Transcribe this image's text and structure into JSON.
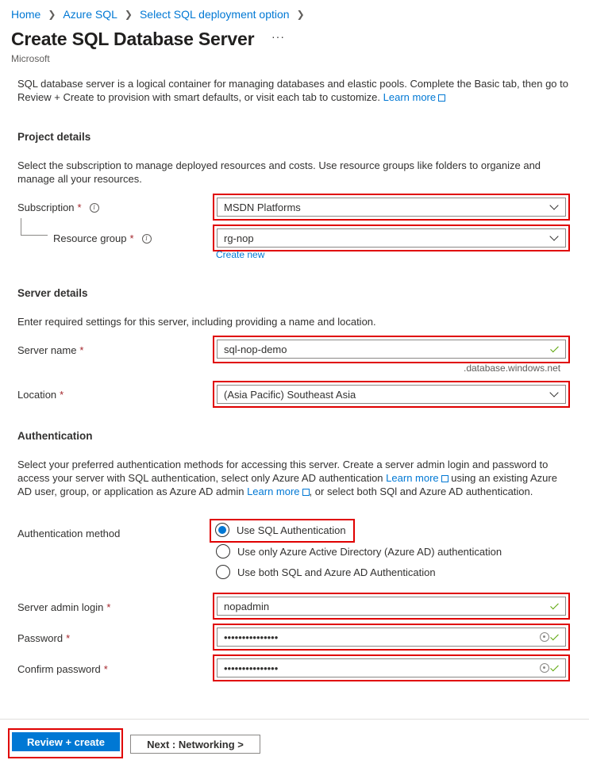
{
  "breadcrumb": {
    "items": [
      "Home",
      "Azure SQL",
      "Select SQL deployment option"
    ]
  },
  "header": {
    "title": "Create SQL Database Server",
    "more_label": "···",
    "publisher": "Microsoft"
  },
  "intro": {
    "text": "SQL database server is a logical container for managing databases and elastic pools. Complete the Basic tab, then go to Review + Create to provision with smart defaults, or visit each tab to customize.",
    "learn_more": "Learn more"
  },
  "project_details": {
    "heading": "Project details",
    "description": "Select the subscription to manage deployed resources and costs. Use resource groups like folders to organize and manage all your resources.",
    "subscription_label": "Subscription",
    "subscription_value": "MSDN Platforms",
    "resource_group_label": "Resource group",
    "resource_group_value": "rg-nop",
    "create_new": "Create new"
  },
  "server_details": {
    "heading": "Server details",
    "description": "Enter required settings for this server, including providing a name and location.",
    "server_name_label": "Server name",
    "server_name_value": "sql-nop-demo",
    "server_name_suffix": ".database.windows.net",
    "location_label": "Location",
    "location_value": "(Asia Pacific) Southeast Asia"
  },
  "authentication": {
    "heading": "Authentication",
    "description_1": "Select your preferred authentication methods for accessing this server. Create a server admin login and password to access your server with SQL authentication, select only Azure AD authentication",
    "learn_more_1": "Learn more",
    "description_2": "using an existing Azure AD user, group, or application as Azure AD admin",
    "learn_more_2": "Learn more",
    "description_3": ", or select both SQl and Azure AD authentication.",
    "method_label": "Authentication method",
    "options": [
      "Use SQL Authentication",
      "Use only Azure Active Directory (Azure AD) authentication",
      "Use both SQL and Azure AD Authentication"
    ],
    "selected_option": 0,
    "admin_login_label": "Server admin login",
    "admin_login_value": "nopadmin",
    "password_label": "Password",
    "password_value": "•••••••••••••••",
    "confirm_password_label": "Confirm password",
    "confirm_password_value": "•••••••••••••••"
  },
  "footer": {
    "review_create": "Review + create",
    "next": "Next : Networking >"
  },
  "required_mark": "*",
  "colors": {
    "accent": "#0078d4",
    "highlight": "#e00000",
    "valid": "#57a300",
    "required": "#a4262c"
  },
  "icons": [
    "chevron-right-icon",
    "more-icon",
    "external-link-icon",
    "info-icon",
    "chevron-down-icon",
    "checkmark-icon",
    "password-reveal-icon"
  ]
}
